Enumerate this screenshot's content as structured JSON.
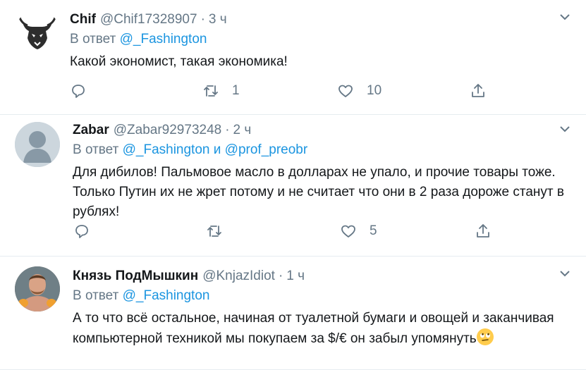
{
  "tweets": [
    {
      "name": "Chif",
      "handle": "@Chif17328907",
      "time": "3 ч",
      "reply_prefix": "В ответ",
      "reply_to": "@_Fashington",
      "reply_and": "",
      "reply_to2": "",
      "text": "Какой экономист, такая экономика!",
      "replies": "",
      "retweets": "1",
      "likes": "10"
    },
    {
      "name": "Zabar",
      "handle": "@Zabar92973248",
      "time": "2 ч",
      "reply_prefix": "В ответ",
      "reply_to": "@_Fashington",
      "reply_and": "и",
      "reply_to2": "@prof_preobr",
      "text": "Для дибилов! Пальмовое масло в долларах не упало, и прочие товары тоже. Только Путин их не жрет потому и не считает что они в 2 раза дороже станут в рублях!",
      "replies": "",
      "retweets": "",
      "likes": "5"
    },
    {
      "name": "Князь ПодМышкин",
      "handle": "@KnjazIdiot",
      "time": "1 ч",
      "reply_prefix": "В ответ",
      "reply_to": "@_Fashington",
      "reply_and": "",
      "reply_to2": "",
      "text": "А то что всё остальное, начиная от туалетной бумаги и овощей и заканчивая компьютерной техникой мы покупаем за $/€ он забыл упомянуть",
      "replies": "",
      "retweets": "",
      "likes": ""
    }
  ],
  "separator": "·",
  "icons": {
    "reply": "reply-icon",
    "retweet": "retweet-icon",
    "like": "heart-icon",
    "share": "share-icon",
    "more": "chevron-down-icon",
    "emoji": "rolling-eyes-emoji-icon"
  },
  "colors": {
    "link": "#1b95e0",
    "secondary": "#657786",
    "divider": "#e6ecf0"
  }
}
